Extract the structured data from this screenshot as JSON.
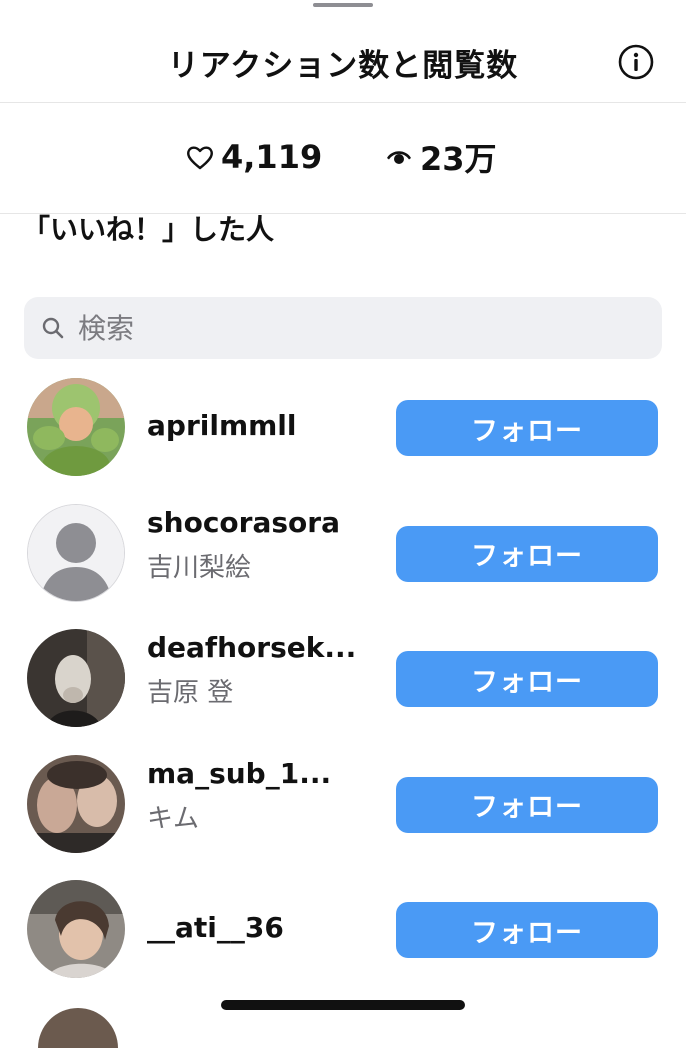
{
  "header": {
    "title": "リアクション数と閲覧数"
  },
  "stats": {
    "likes": "4,119",
    "views": "23万"
  },
  "section_heading": "「いいね！」した人",
  "search": {
    "placeholder": "検索",
    "value": ""
  },
  "follow_label": "フォロー",
  "users": [
    {
      "username": "aprilmmll",
      "fullname": "",
      "avatar": "cabbage-costume-child-photo"
    },
    {
      "username": "shocorasora",
      "fullname": "吉川梨絵",
      "avatar": "default-person-avatar"
    },
    {
      "username": "deafhorsek...",
      "fullname": "吉原 登",
      "avatar": "horse-mask-photo"
    },
    {
      "username": "ma_sub_1...",
      "fullname": "キム",
      "avatar": "blurry-selfie-photo"
    },
    {
      "username": "__ati__36",
      "fullname": "",
      "avatar": "woman-portrait-photo"
    }
  ],
  "colors": {
    "follow_button": "#4a9af5",
    "search_background": "#eff0f3",
    "secondary_text": "#6b6b70"
  }
}
